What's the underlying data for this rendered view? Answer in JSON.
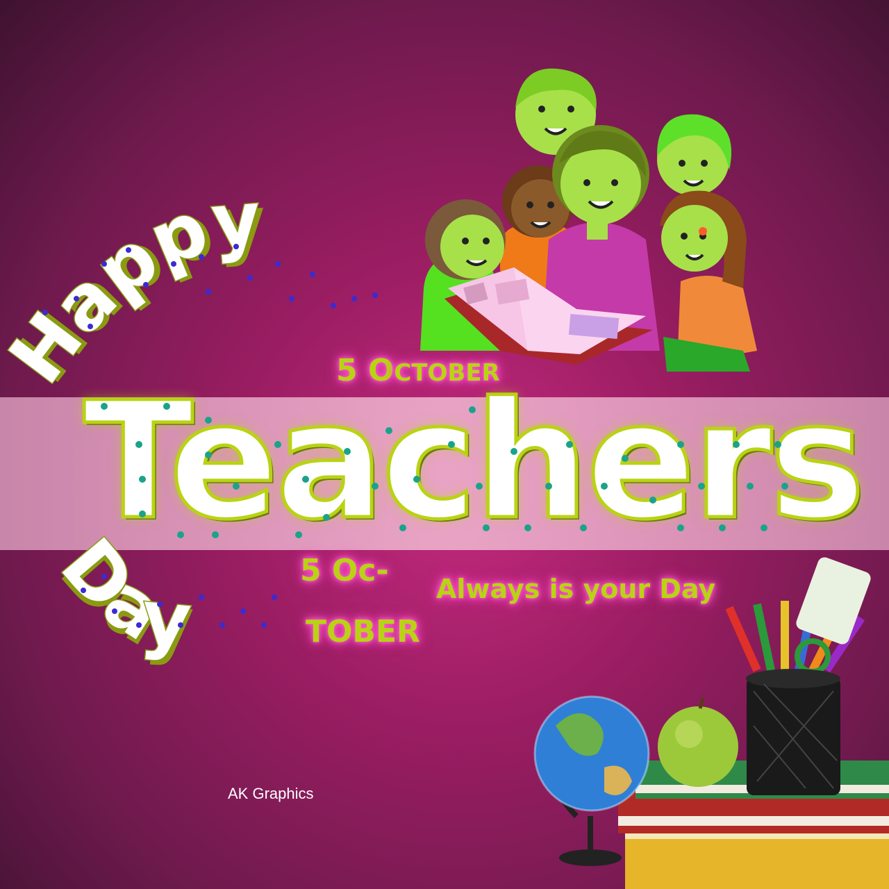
{
  "greeting": {
    "happy": "Happy",
    "day": "Day",
    "main_word": "Teachers"
  },
  "date_top": {
    "number": "5",
    "month_first": "O",
    "month_rest": "CTOBER"
  },
  "date_split": {
    "line1": "5 Oc-",
    "line2": "TOBER"
  },
  "tagline": "Always is your Day",
  "credit": "AK Graphics",
  "colors": {
    "accent": "#b9d314",
    "glow": "#ff59d0",
    "dot_teal": "#1aa38a",
    "dot_blue": "#3b2bd0",
    "band": "#e8a9c8"
  },
  "illustrations": [
    "teacher-with-children-reading",
    "globe-icon",
    "apple-icon",
    "books-stack-icon",
    "pencil-cup-icon"
  ]
}
